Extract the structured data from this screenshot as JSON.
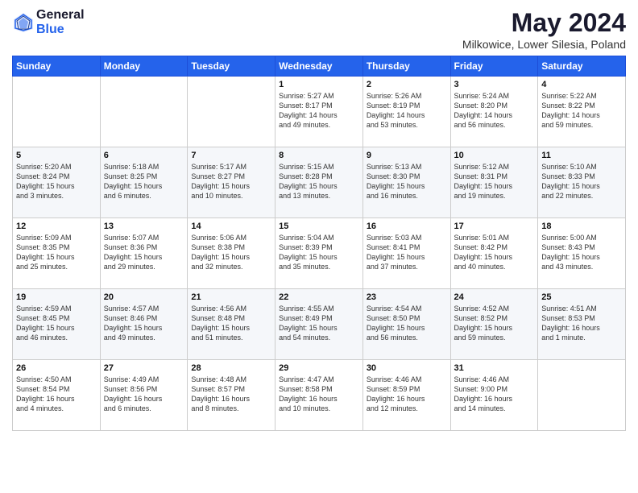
{
  "logo": {
    "general": "General",
    "blue": "Blue"
  },
  "title": "May 2024",
  "subtitle": "Milkowice, Lower Silesia, Poland",
  "days_of_week": [
    "Sunday",
    "Monday",
    "Tuesday",
    "Wednesday",
    "Thursday",
    "Friday",
    "Saturday"
  ],
  "weeks": [
    [
      {
        "day": "",
        "content": ""
      },
      {
        "day": "",
        "content": ""
      },
      {
        "day": "",
        "content": ""
      },
      {
        "day": "1",
        "content": "Sunrise: 5:27 AM\nSunset: 8:17 PM\nDaylight: 14 hours\nand 49 minutes."
      },
      {
        "day": "2",
        "content": "Sunrise: 5:26 AM\nSunset: 8:19 PM\nDaylight: 14 hours\nand 53 minutes."
      },
      {
        "day": "3",
        "content": "Sunrise: 5:24 AM\nSunset: 8:20 PM\nDaylight: 14 hours\nand 56 minutes."
      },
      {
        "day": "4",
        "content": "Sunrise: 5:22 AM\nSunset: 8:22 PM\nDaylight: 14 hours\nand 59 minutes."
      }
    ],
    [
      {
        "day": "5",
        "content": "Sunrise: 5:20 AM\nSunset: 8:24 PM\nDaylight: 15 hours\nand 3 minutes."
      },
      {
        "day": "6",
        "content": "Sunrise: 5:18 AM\nSunset: 8:25 PM\nDaylight: 15 hours\nand 6 minutes."
      },
      {
        "day": "7",
        "content": "Sunrise: 5:17 AM\nSunset: 8:27 PM\nDaylight: 15 hours\nand 10 minutes."
      },
      {
        "day": "8",
        "content": "Sunrise: 5:15 AM\nSunset: 8:28 PM\nDaylight: 15 hours\nand 13 minutes."
      },
      {
        "day": "9",
        "content": "Sunrise: 5:13 AM\nSunset: 8:30 PM\nDaylight: 15 hours\nand 16 minutes."
      },
      {
        "day": "10",
        "content": "Sunrise: 5:12 AM\nSunset: 8:31 PM\nDaylight: 15 hours\nand 19 minutes."
      },
      {
        "day": "11",
        "content": "Sunrise: 5:10 AM\nSunset: 8:33 PM\nDaylight: 15 hours\nand 22 minutes."
      }
    ],
    [
      {
        "day": "12",
        "content": "Sunrise: 5:09 AM\nSunset: 8:35 PM\nDaylight: 15 hours\nand 25 minutes."
      },
      {
        "day": "13",
        "content": "Sunrise: 5:07 AM\nSunset: 8:36 PM\nDaylight: 15 hours\nand 29 minutes."
      },
      {
        "day": "14",
        "content": "Sunrise: 5:06 AM\nSunset: 8:38 PM\nDaylight: 15 hours\nand 32 minutes."
      },
      {
        "day": "15",
        "content": "Sunrise: 5:04 AM\nSunset: 8:39 PM\nDaylight: 15 hours\nand 35 minutes."
      },
      {
        "day": "16",
        "content": "Sunrise: 5:03 AM\nSunset: 8:41 PM\nDaylight: 15 hours\nand 37 minutes."
      },
      {
        "day": "17",
        "content": "Sunrise: 5:01 AM\nSunset: 8:42 PM\nDaylight: 15 hours\nand 40 minutes."
      },
      {
        "day": "18",
        "content": "Sunrise: 5:00 AM\nSunset: 8:43 PM\nDaylight: 15 hours\nand 43 minutes."
      }
    ],
    [
      {
        "day": "19",
        "content": "Sunrise: 4:59 AM\nSunset: 8:45 PM\nDaylight: 15 hours\nand 46 minutes."
      },
      {
        "day": "20",
        "content": "Sunrise: 4:57 AM\nSunset: 8:46 PM\nDaylight: 15 hours\nand 49 minutes."
      },
      {
        "day": "21",
        "content": "Sunrise: 4:56 AM\nSunset: 8:48 PM\nDaylight: 15 hours\nand 51 minutes."
      },
      {
        "day": "22",
        "content": "Sunrise: 4:55 AM\nSunset: 8:49 PM\nDaylight: 15 hours\nand 54 minutes."
      },
      {
        "day": "23",
        "content": "Sunrise: 4:54 AM\nSunset: 8:50 PM\nDaylight: 15 hours\nand 56 minutes."
      },
      {
        "day": "24",
        "content": "Sunrise: 4:52 AM\nSunset: 8:52 PM\nDaylight: 15 hours\nand 59 minutes."
      },
      {
        "day": "25",
        "content": "Sunrise: 4:51 AM\nSunset: 8:53 PM\nDaylight: 16 hours\nand 1 minute."
      }
    ],
    [
      {
        "day": "26",
        "content": "Sunrise: 4:50 AM\nSunset: 8:54 PM\nDaylight: 16 hours\nand 4 minutes."
      },
      {
        "day": "27",
        "content": "Sunrise: 4:49 AM\nSunset: 8:56 PM\nDaylight: 16 hours\nand 6 minutes."
      },
      {
        "day": "28",
        "content": "Sunrise: 4:48 AM\nSunset: 8:57 PM\nDaylight: 16 hours\nand 8 minutes."
      },
      {
        "day": "29",
        "content": "Sunrise: 4:47 AM\nSunset: 8:58 PM\nDaylight: 16 hours\nand 10 minutes."
      },
      {
        "day": "30",
        "content": "Sunrise: 4:46 AM\nSunset: 8:59 PM\nDaylight: 16 hours\nand 12 minutes."
      },
      {
        "day": "31",
        "content": "Sunrise: 4:46 AM\nSunset: 9:00 PM\nDaylight: 16 hours\nand 14 minutes."
      },
      {
        "day": "",
        "content": ""
      }
    ]
  ]
}
